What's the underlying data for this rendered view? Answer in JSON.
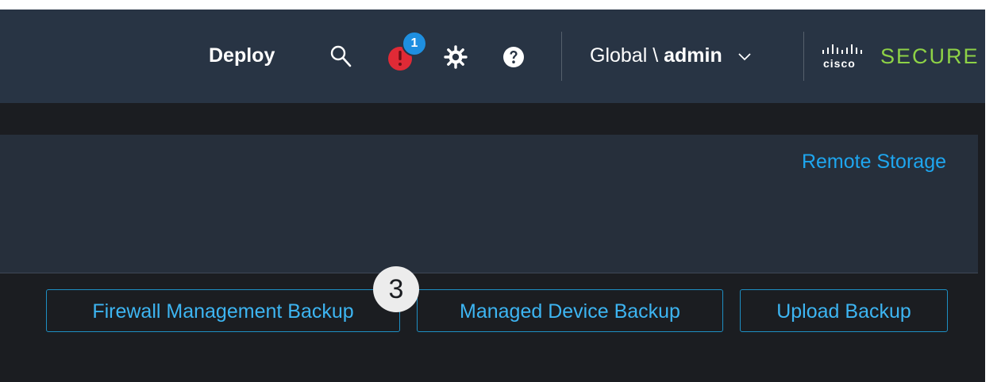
{
  "header": {
    "deploy_label": "Deploy",
    "notification_count": "1",
    "domain_prefix": "Global \\ ",
    "user_name": "admin",
    "logo_cisco": "cisco",
    "logo_secure": "SECURE",
    "icons": [
      "search-icon",
      "alert-icon",
      "gear-icon",
      "help-icon",
      "chevron-down-icon"
    ]
  },
  "panel": {
    "remote_storage_link": "Remote Storage"
  },
  "actions": {
    "fmc_backup": "Firewall Management Backup",
    "device_backup": "Managed Device Backup",
    "upload_backup": "Upload Backup"
  },
  "annotation": {
    "step": "3"
  },
  "colors": {
    "header_bg": "#283444",
    "page_bg": "#1b1d21",
    "panel_bg": "#262f3b",
    "link": "#1ea6ef",
    "badge": "#1e8fe0",
    "alert": "#e02a36",
    "brand_green": "#8ed246"
  }
}
